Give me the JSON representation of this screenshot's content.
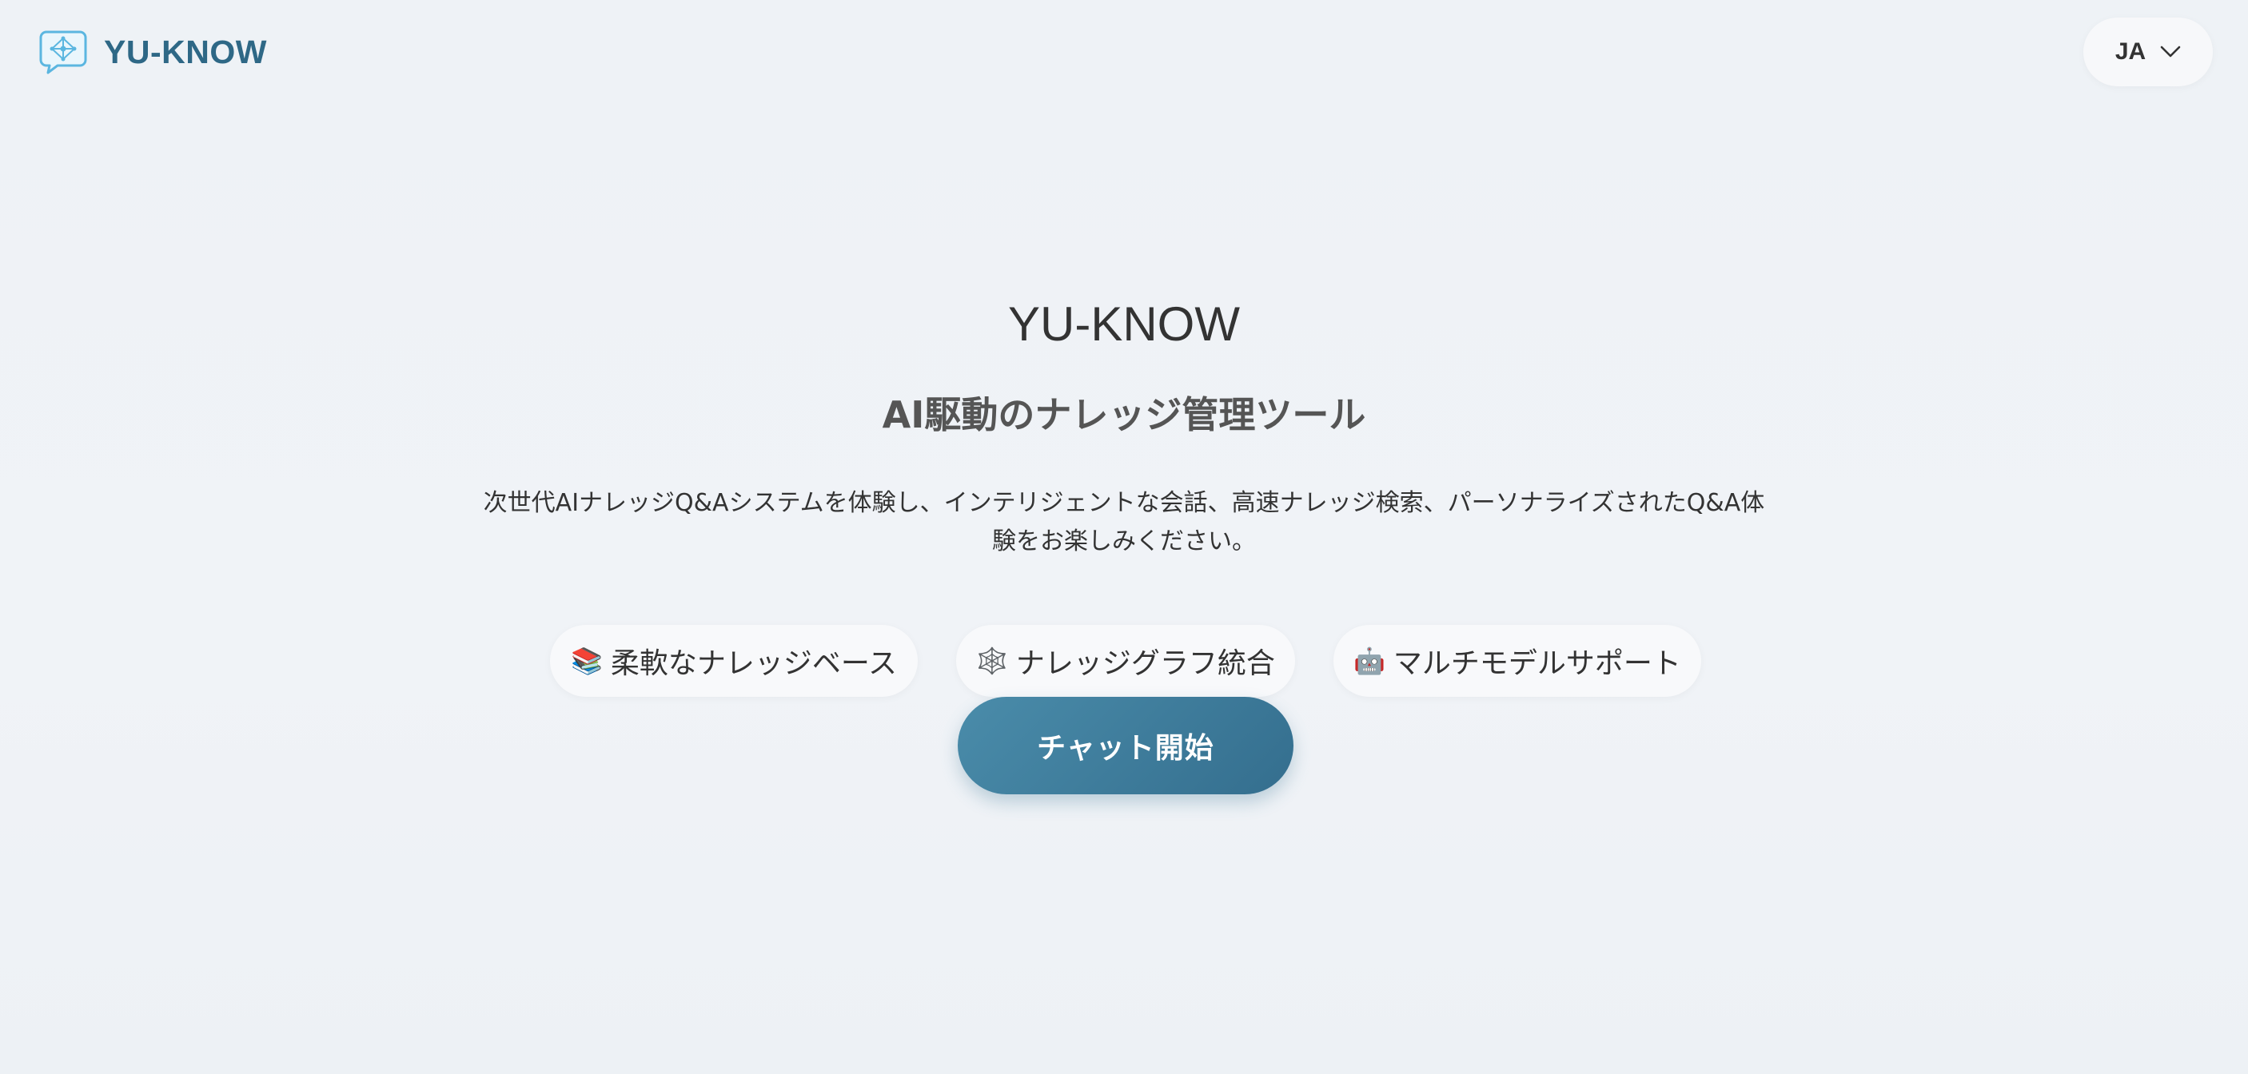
{
  "header": {
    "brand_name": "YU-KNOW",
    "logo_icon": "chat-bubble-network-icon",
    "language": {
      "selected": "JA",
      "icon": "chevron-down-icon"
    }
  },
  "hero": {
    "title": "YU-KNOW",
    "subtitle": "AI駆動のナレッジ管理ツール",
    "description": "次世代AIナレッジQ&Aシステムを体験し、インテリジェントな会話、高速ナレッジ検索、パーソナライズされたQ&A体験をお楽しみください。"
  },
  "features": [
    {
      "emoji": "📚",
      "icon": "books-icon",
      "label": "柔軟なナレッジベース"
    },
    {
      "emoji": "🕸️",
      "icon": "spider-web-icon",
      "label": "ナレッジグラフ統合"
    },
    {
      "emoji": "🤖",
      "icon": "robot-icon",
      "label": "マルチモデルサポート"
    }
  ],
  "cta": {
    "label": "チャット開始"
  },
  "colors": {
    "brand": "#2e6886",
    "accent_start": "#4a8caa",
    "accent_end": "#346e8e",
    "background": "#eef2f6"
  }
}
